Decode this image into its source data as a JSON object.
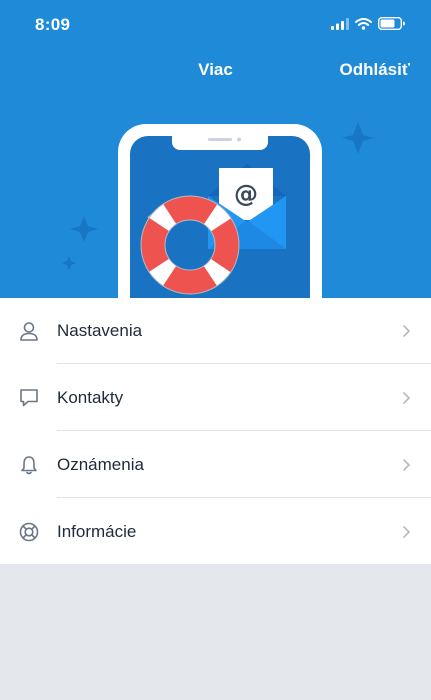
{
  "status_bar": {
    "time": "8:09"
  },
  "header": {
    "title": "Viac",
    "logout_label": "Odhlásiť"
  },
  "menu": {
    "items": [
      {
        "label": "Nastavenia",
        "icon": "user-icon"
      },
      {
        "label": "Kontakty",
        "icon": "chat-bubble-icon"
      },
      {
        "label": "Oznámenia",
        "icon": "bell-icon"
      },
      {
        "label": "Informácie",
        "icon": "lifebuoy-icon"
      }
    ]
  },
  "colors": {
    "header_bg": "#1e8ad8",
    "page_bg": "#e4e7ec",
    "text": "#1d2b3a"
  }
}
